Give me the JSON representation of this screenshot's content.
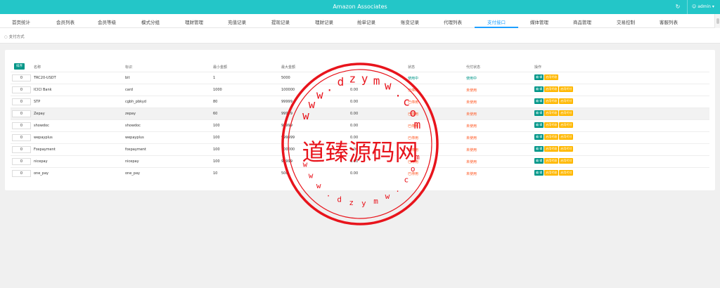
{
  "app": {
    "title": "Amazon Associates",
    "user": "admin",
    "user_icon": "user-icon",
    "refresh_icon": "refresh-icon"
  },
  "nav": {
    "tabs": [
      {
        "label": "首页统计"
      },
      {
        "label": "会员列表"
      },
      {
        "label": "会员等级"
      },
      {
        "label": "模式分组"
      },
      {
        "label": "理财管理"
      },
      {
        "label": "充值记录"
      },
      {
        "label": "提现记录"
      },
      {
        "label": "理财记录"
      },
      {
        "label": "抢单记录"
      },
      {
        "label": "账变记录"
      },
      {
        "label": "代理列表"
      },
      {
        "label": "支付接口"
      },
      {
        "label": "媒体管理"
      },
      {
        "label": "商品管理"
      },
      {
        "label": "交易控制"
      },
      {
        "label": "客服列表"
      }
    ],
    "active": "支付接口"
  },
  "breadcrumb": {
    "label": "支付方式"
  },
  "table": {
    "sort_button": "排序",
    "headers": {
      "name": "名称",
      "code": "标识",
      "min": "最小金额",
      "max": "最大金额",
      "fee": "",
      "status": "状态",
      "pay_status": "代付状态",
      "ops": "操作"
    },
    "actions": {
      "edit": "编 辑",
      "toggle": "启用代收",
      "payout": "启用代付"
    },
    "rows": [
      {
        "sort": "0",
        "name": "TRC20-USDT",
        "code": "bit",
        "min": "1",
        "max": "5000",
        "fee": "",
        "status": "使用中",
        "pay_status": "使用中"
      },
      {
        "sort": "0",
        "name": "ICICI Bank",
        "code": "card",
        "min": "1000",
        "max": "100000",
        "fee": "0.00",
        "status": "已停用",
        "pay_status": "未使用"
      },
      {
        "sort": "0",
        "name": "STP",
        "code": "cgbh_pbkyd",
        "min": "80",
        "max": "99999",
        "fee": "0.00",
        "status": "已停用",
        "pay_status": "未使用"
      },
      {
        "sort": "0",
        "name": "Zepay",
        "code": "zepay",
        "min": "60",
        "max": "99999",
        "fee": "0.00",
        "status": "已停用",
        "pay_status": "未使用"
      },
      {
        "sort": "0",
        "name": "showdoc",
        "code": "showdoc",
        "min": "100",
        "max": "99999",
        "fee": "0.00",
        "status": "已停用",
        "pay_status": "未使用"
      },
      {
        "sort": "0",
        "name": "wepayplus",
        "code": "wepayplus",
        "min": "100",
        "max": "999999",
        "fee": "0.00",
        "status": "已停用",
        "pay_status": "未使用"
      },
      {
        "sort": "0",
        "name": "Foxpayment",
        "code": "foxpayment",
        "min": "100",
        "max": "100000",
        "fee": "0.00",
        "status": "已停用",
        "pay_status": "未使用"
      },
      {
        "sort": "0",
        "name": "nicepay",
        "code": "nicepay",
        "min": "100",
        "max": "99999",
        "fee": "0.00",
        "status": "已停用",
        "pay_status": "未使用"
      },
      {
        "sort": "0",
        "name": "one_pay",
        "code": "one_pay",
        "min": "10",
        "max": "500",
        "fee": "0.00",
        "status": "已停用",
        "pay_status": "未使用"
      }
    ]
  },
  "watermark": {
    "text": "道臻源码网",
    "url_text": "w w w . d z y m w . c o m"
  },
  "colors": {
    "accent": "#23c6c8",
    "active_tab": "#1e9fff",
    "green": "#009688",
    "yellow": "#ffb800",
    "stop": "#ff5722",
    "watermark": "#e8141c"
  }
}
